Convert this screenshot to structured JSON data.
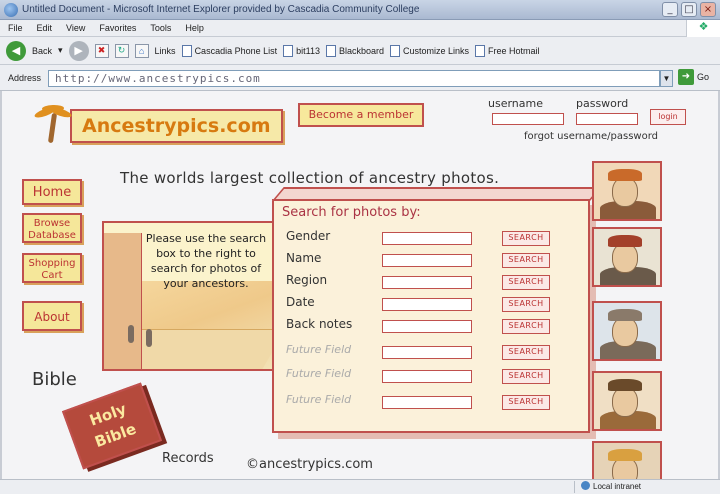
{
  "browser": {
    "window_title": "Untitled Document - Microsoft Internet Explorer provided by Cascadia Community College",
    "menu": [
      "File",
      "Edit",
      "View",
      "Favorites",
      "Tools",
      "Help"
    ],
    "toolbar": {
      "back_label": "Back",
      "links_label": "Links",
      "links": [
        "Cascadia Phone List",
        "bit113",
        "Blackboard",
        "Customize Links",
        "Free Hotmail"
      ]
    },
    "address_label": "Address",
    "address_value": "http://www.ancestrypics.com",
    "go_label": "Go",
    "status_zone": "Local intranet"
  },
  "page": {
    "logo_text": "Ancestrypics.com",
    "become_member_label": "Become a member",
    "login": {
      "username_label": "username",
      "password_label": "password",
      "login_button": "login",
      "forgot_label": "forgot username/password"
    },
    "tagline": "The worlds largest collection of ancestry photos.",
    "nav": {
      "home": "Home",
      "browse": "Browse Database",
      "cart": "Shopping Cart",
      "about": "About"
    },
    "instructions": "Please use the search box to the right to search for photos of your ancestors.",
    "search": {
      "title": "Search for photos by:",
      "button_label": "SEARCH",
      "fields": [
        {
          "label": "Gender",
          "future": false
        },
        {
          "label": "Name",
          "future": false
        },
        {
          "label": "Region",
          "future": false
        },
        {
          "label": "Date",
          "future": false
        },
        {
          "label": "Back notes",
          "future": false
        },
        {
          "label": "Future Field",
          "future": true
        },
        {
          "label": "Future Field",
          "future": true
        },
        {
          "label": "Future Field",
          "future": true
        }
      ]
    },
    "bible_label": "Bible",
    "bible_book_text": "Holy Bible",
    "records_label": "Records",
    "copyright": "©ancestrypics.com"
  }
}
